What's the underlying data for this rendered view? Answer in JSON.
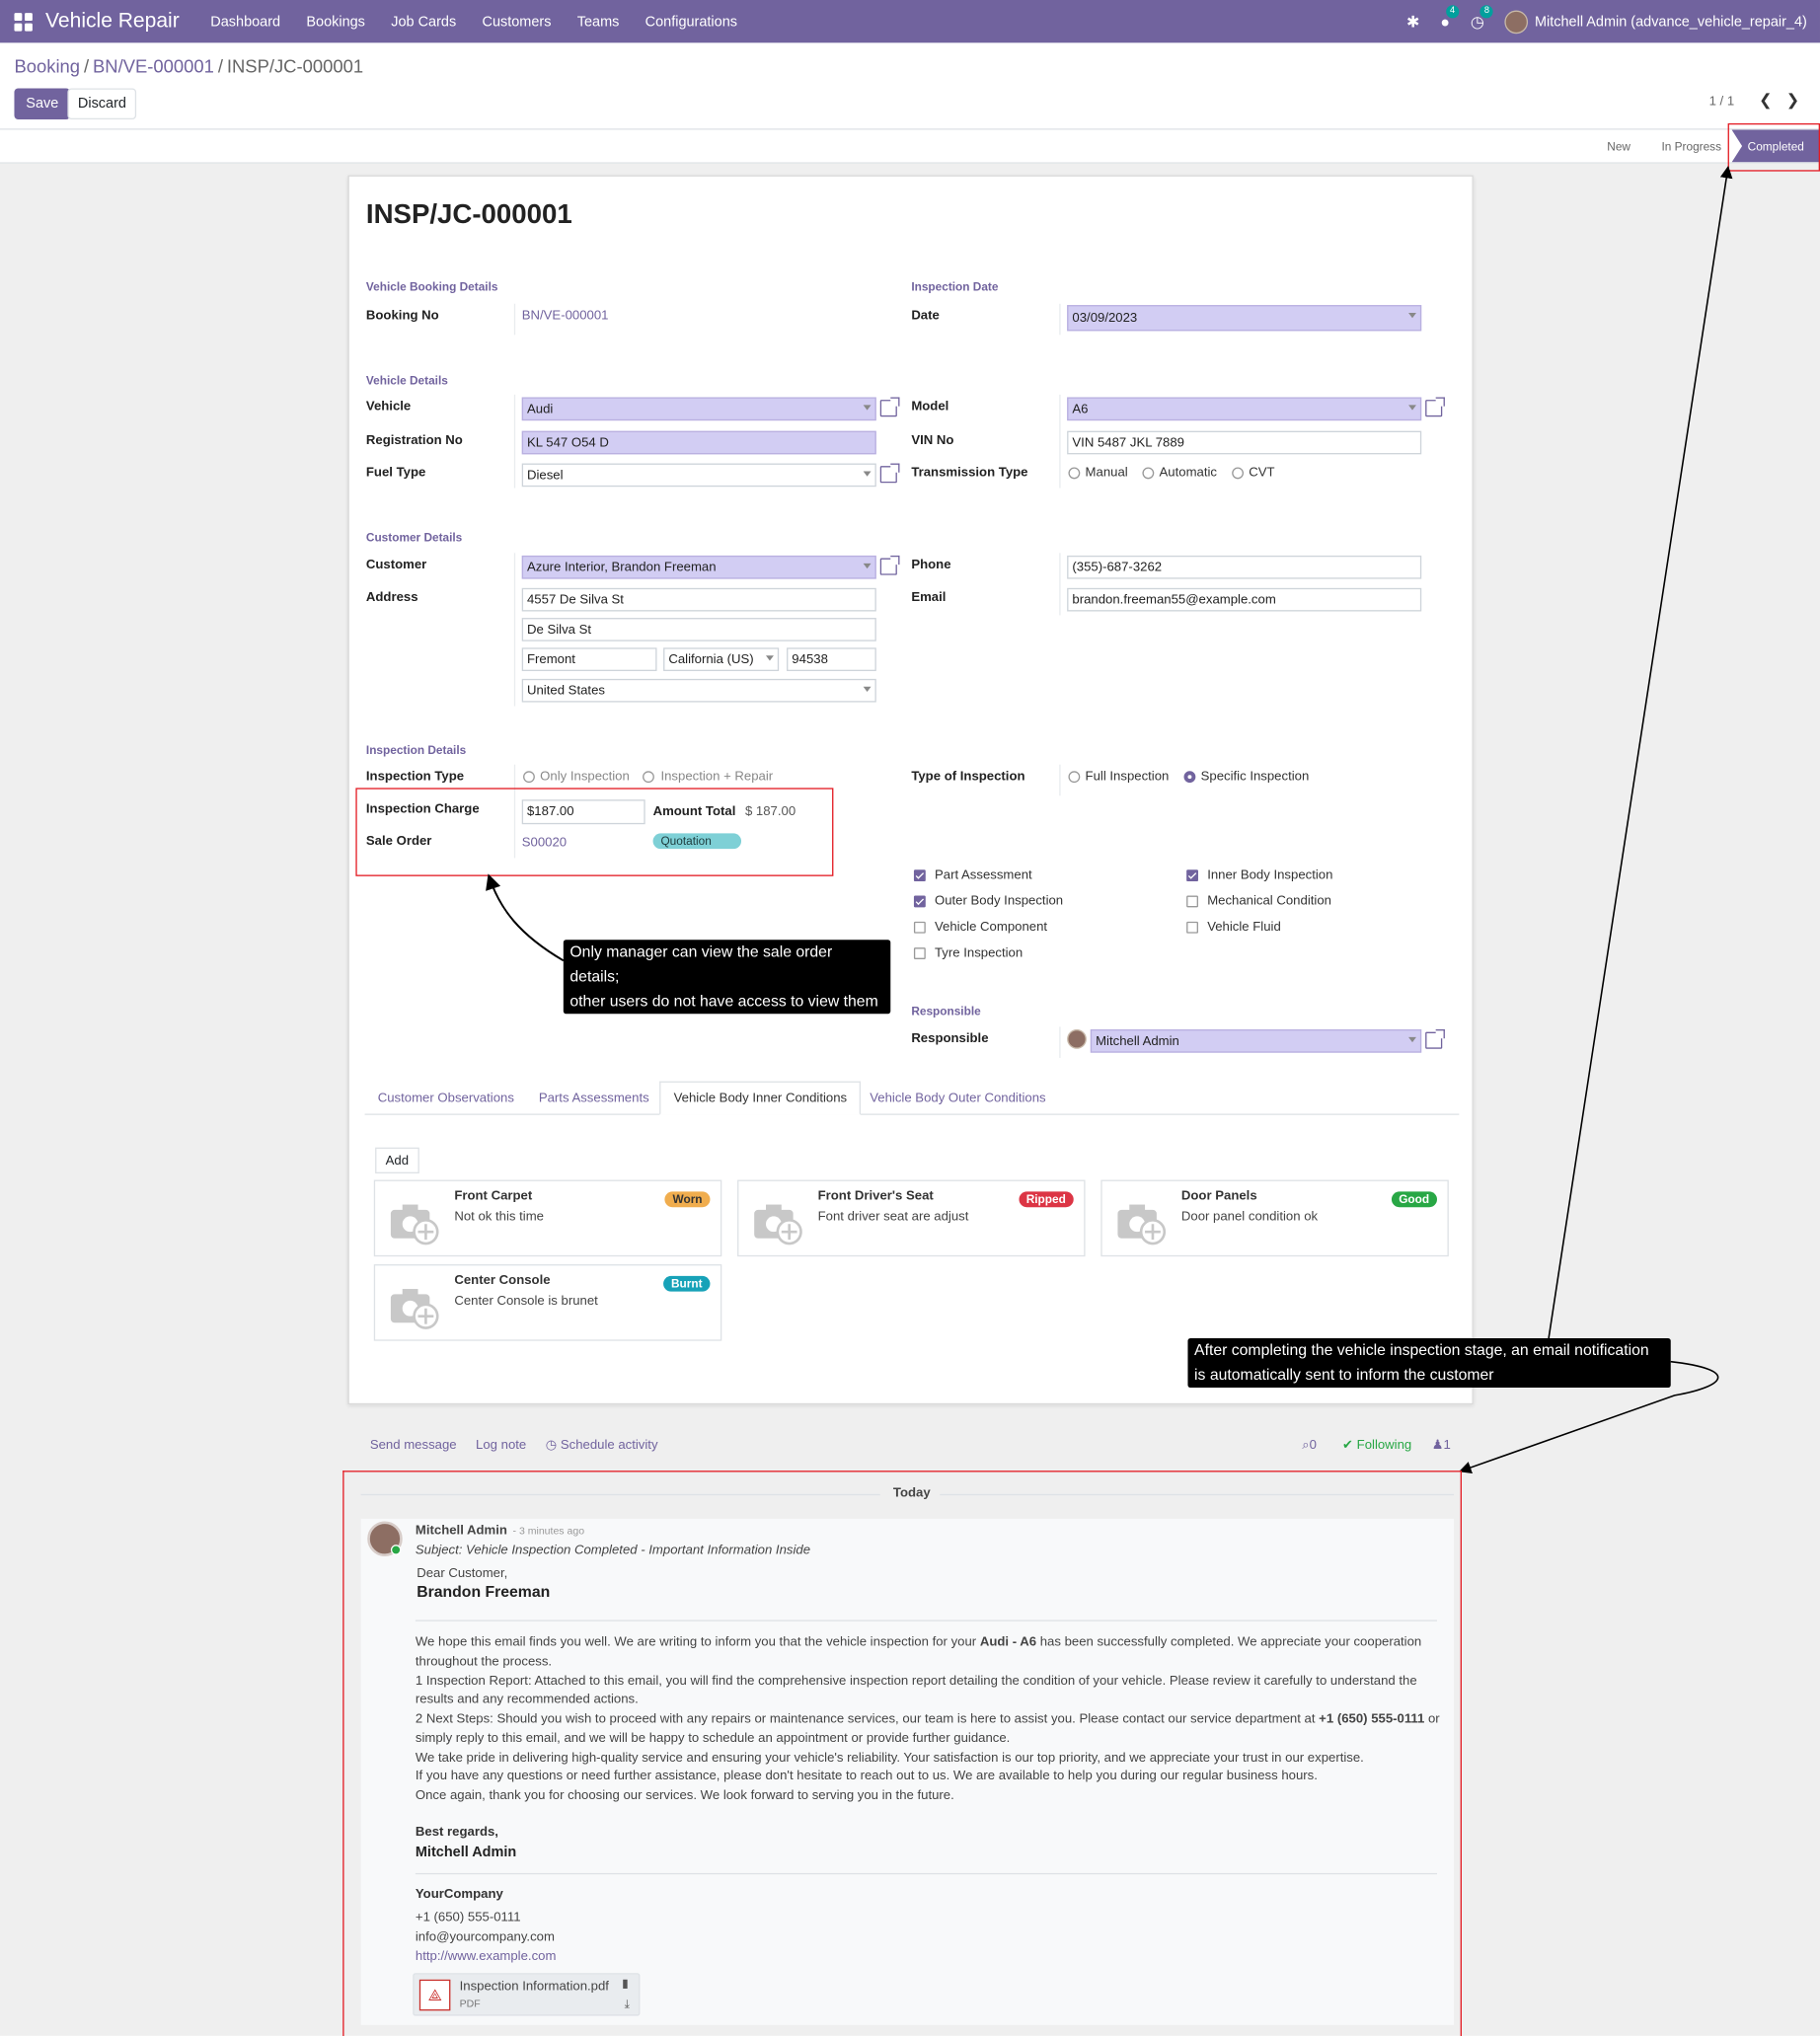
{
  "app": {
    "name": "Vehicle Repair",
    "menu": [
      "Dashboard",
      "Bookings",
      "Job Cards",
      "Customers",
      "Teams",
      "Configurations"
    ],
    "user": "Mitchell Admin (advance_vehicle_repair_4)",
    "msg_count": "4",
    "activity_count": "8",
    "accent": "#71639e"
  },
  "breadcrumb": {
    "root": "Booking",
    "mid": "BN/VE-000001",
    "current": "INSP/JC-000001"
  },
  "buttons": {
    "save": "Save",
    "discard": "Discard",
    "add": "Add"
  },
  "pager": "1 / 1",
  "stages": [
    "New",
    "In Progress",
    "Completed"
  ],
  "form": {
    "title": "INSP/JC-000001",
    "groups": {
      "booking": "Vehicle Booking Details",
      "insp_date": "Inspection Date",
      "vehicle": "Vehicle Details",
      "customer": "Customer Details",
      "inspection": "Inspection Details",
      "responsible": "Responsible"
    },
    "labels": {
      "booking_no": "Booking No",
      "date": "Date",
      "vehicle": "Vehicle",
      "model": "Model",
      "reg_no": "Registration No",
      "vin": "VIN No",
      "fuel": "Fuel Type",
      "transmission": "Transmission Type",
      "customer": "Customer",
      "phone": "Phone",
      "address": "Address",
      "email": "Email",
      "insp_type": "Inspection Type",
      "type_of_insp": "Type of Inspection",
      "insp_charge": "Inspection Charge",
      "amount_total": "Amount Total",
      "sale_order": "Sale Order",
      "responsible": "Responsible"
    },
    "values": {
      "booking_no": "BN/VE-000001",
      "date": "03/09/2023",
      "vehicle": "Audi",
      "model": "A6",
      "reg_no": "KL 547 O54 D",
      "vin": "VIN 5487 JKL 7889",
      "fuel": "Diesel",
      "customer": "Azure Interior, Brandon Freeman",
      "phone": "(355)-687-3262",
      "street": "4557 De Silva St",
      "street2": "De Silva St",
      "city": "Fremont",
      "state": "California (US)",
      "zip": "94538",
      "country": "United States",
      "email": "brandon.freeman55@example.com",
      "insp_charge": "$187.00",
      "amount_total": "$ 187.00",
      "sale_order": "S00020",
      "so_status": "Quotation",
      "responsible": "Mitchell Admin"
    },
    "transmission_opts": [
      "Manual",
      "Automatic",
      "CVT"
    ],
    "insp_type_opts": [
      "Only Inspection",
      "Inspection + Repair"
    ],
    "type_of_insp_opts": [
      "Full Inspection",
      "Specific Inspection"
    ],
    "checks": [
      {
        "label": "Part Assessment",
        "on": true
      },
      {
        "label": "Inner Body Inspection",
        "on": true
      },
      {
        "label": "Outer Body Inspection",
        "on": true
      },
      {
        "label": "Mechanical Condition",
        "on": false
      },
      {
        "label": "Vehicle Component",
        "on": false
      },
      {
        "label": "Vehicle Fluid",
        "on": false
      },
      {
        "label": "Tyre Inspection",
        "on": false
      }
    ]
  },
  "tabs": [
    "Customer Observations",
    "Parts Assessments",
    "Vehicle Body Inner Conditions",
    "Vehicle Body Outer Conditions"
  ],
  "cards": [
    {
      "title": "Front Carpet",
      "desc": "Not ok this time",
      "tag": "Worn",
      "color": "#f0ad4e"
    },
    {
      "title": "Front Driver's Seat",
      "desc": "Font driver seat are adjust",
      "tag": "Ripped",
      "color": "#dc3545"
    },
    {
      "title": "Door Panels",
      "desc": "Door panel condition ok",
      "tag": "Good",
      "color": "#28a745"
    },
    {
      "title": "Center Console",
      "desc": "Center Console is brunet",
      "tag": "Burnt",
      "color": "#17a2b8"
    }
  ],
  "notes": {
    "manager": [
      "Only manager can view the sale order details;",
      "other users do not have access to view them"
    ],
    "email": [
      "After completing the vehicle inspection stage, an email notification",
      "is automatically sent to inform the customer"
    ]
  },
  "chatter": {
    "send": "Send message",
    "log": "Log note",
    "schedule": "Schedule activity",
    "attachments": "0",
    "following": "Following",
    "followers": "1",
    "day": "Today"
  },
  "message": {
    "author": "Mitchell Admin",
    "time": "- 3 minutes ago",
    "subject": "Subject: Vehicle Inspection Completed - Important Information Inside",
    "greeting": "Dear Customer,",
    "name": "Brandon Freeman",
    "p1a": "We hope this email finds you well. We are writing to inform you that the vehicle inspection for your ",
    "p1b": "Audi -  A6",
    "p1c": " has been successfully completed. We appreciate your cooperation",
    "p1d": "throughout the process.",
    "p2a": "1 Inspection Report: Attached to this email, you will find the comprehensive inspection report detailing the condition of your vehicle. Please review it carefully to understand the",
    "p2b": "results and any recommended actions.",
    "p3a": "2 Next Steps: Should you wish to proceed with any repairs or maintenance services, our team is here to assist you. Please contact our service department at ",
    "p3b": "+1 (650) 555-0111",
    "p3c": " or",
    "p3d": "simply reply to this email, and we will be happy to schedule an appointment or provide further guidance.",
    "p4": "We take pride in delivering high-quality service and ensuring your vehicle's reliability. Your satisfaction is our top priority, and we appreciate your trust in our expertise.",
    "p5": "If you have any questions or need further assistance, please don't hesitate to reach out to us. We are available to help you during our regular business hours.",
    "p6": "Once again, thank you for choosing our services. We look forward to serving you in the future.",
    "regards": "Best regards,",
    "signer": "Mitchell Admin",
    "company": "YourCompany",
    "c_phone": "+1 (650) 555-0111",
    "c_email": "info@yourcompany.com",
    "c_web": "http://www.example.com",
    "file": "Inspection Information.pdf",
    "file_type": "PDF"
  }
}
